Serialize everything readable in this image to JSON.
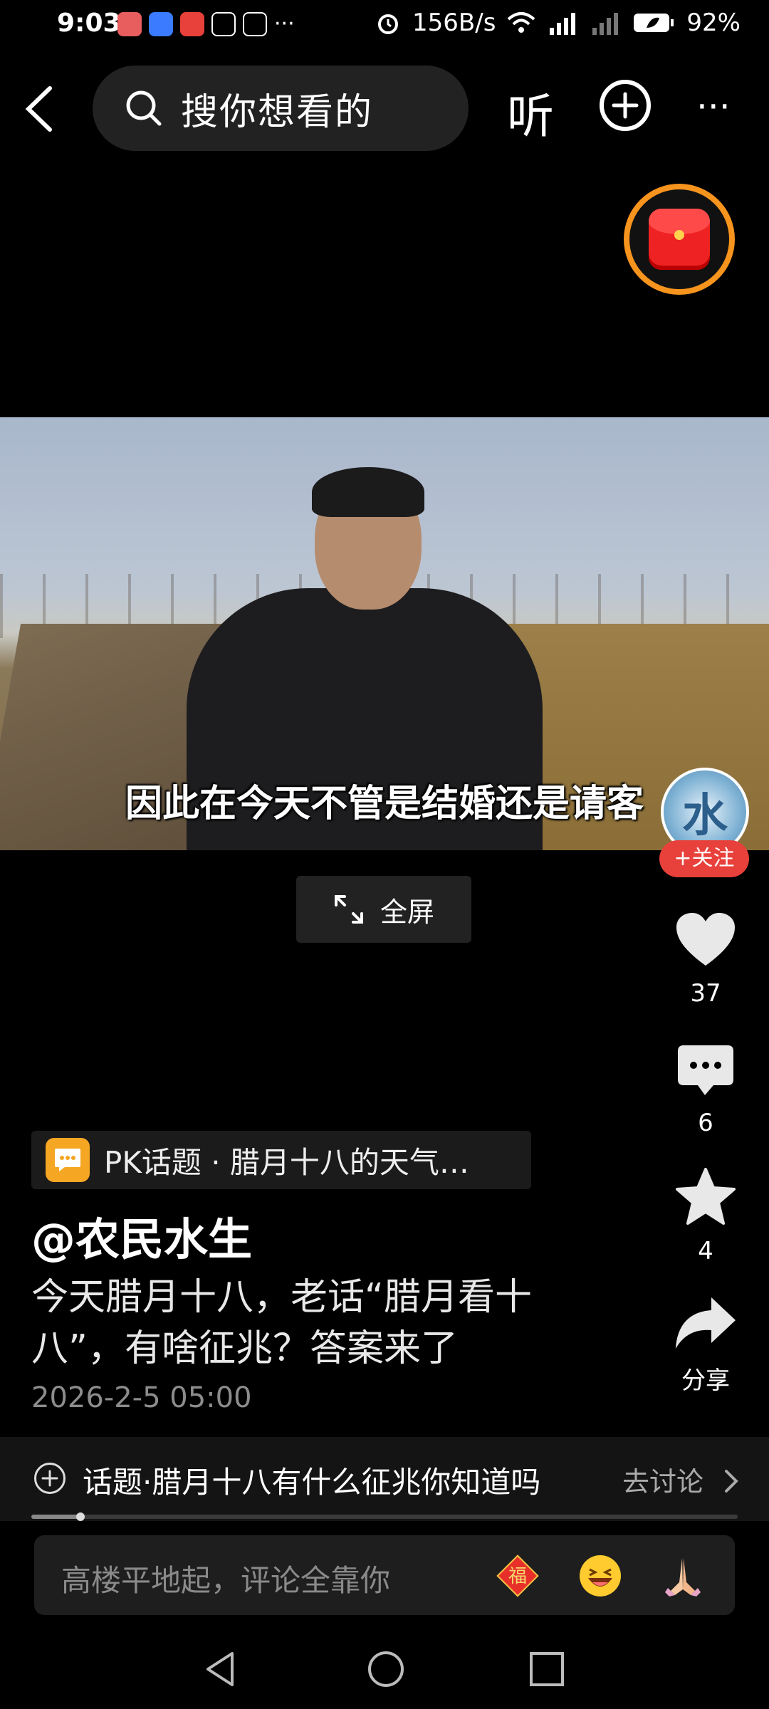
{
  "status_bar": {
    "time": "9:03",
    "speed": "156B/s",
    "battery": "92%",
    "more": "···"
  },
  "top_bar": {
    "search_placeholder": "搜你想看的",
    "listen_label": "听",
    "more_label": "···"
  },
  "video": {
    "subtitle": "因此在今天不管是结婚还是请客",
    "fullscreen_label": "全屏"
  },
  "creator": {
    "avatar_char": "水",
    "follow_label": "+关注"
  },
  "actions": {
    "likes": "37",
    "comments": "6",
    "favorites": "4",
    "share_label": "分享"
  },
  "post": {
    "topic_tag": "PK话题 · 腊月十八的天气…",
    "author": "@农民水生",
    "description": "今天腊月十八，老话“腊月看十八”，有啥征兆？答案来了",
    "date": "2026-2-5 05:00"
  },
  "topic_bar": {
    "label": "话题·腊月十八有什么征兆你知道吗",
    "discuss_label": "去讨论"
  },
  "playback": {
    "progress": 0.07
  },
  "comment_input": {
    "placeholder": "高楼平地起，评论全靠你",
    "fu_char": "福"
  }
}
